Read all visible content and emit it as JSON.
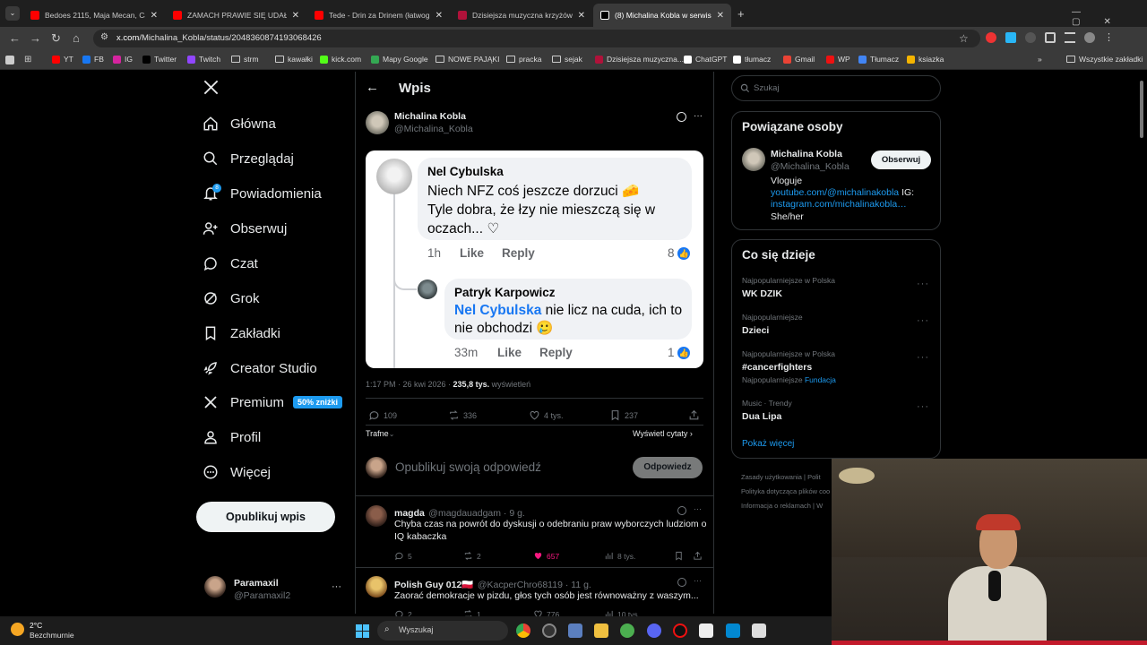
{
  "browser": {
    "tabs": [
      {
        "title": "Bedoes 2115, Maja Mecan, Cam",
        "color": "#ff0000",
        "active": false
      },
      {
        "title": "ZAMACH PRAWIE SIĘ UDAŁ - Yo",
        "color": "#ff0000",
        "active": false
      },
      {
        "title": "Tede - Drin za Drinem (łatwog",
        "color": "#ff0000",
        "active": false
      },
      {
        "title": "Dzisiejsza muzyczna krzyżówka",
        "color": "#b0123a",
        "active": false
      },
      {
        "title": "(8) Michalina Kobla w serwisie X",
        "color": "#000000",
        "active": true
      }
    ],
    "url_host": "x.com",
    "url_path": "/Michalina_Kobla/status/2048360874193068426",
    "bookmarks": [
      "YT",
      "FB",
      "IG",
      "Twitter",
      "Twitch",
      "strm",
      "kawałki",
      "kick.com",
      "Mapy Google",
      "NOWE PAJĄKI",
      "pracka",
      "sejak",
      "Dzisiejsza muzyczna...",
      "ChatGPT",
      "tłumacz",
      "Gmail",
      "WP",
      "Tłumacz",
      "ksiazka"
    ],
    "bookmarks_more": "»",
    "all_bookmarks": "Wszystkie zakładki"
  },
  "sidebar": {
    "items": [
      {
        "label": "Główna",
        "icon": "home-icon"
      },
      {
        "label": "Przeglądaj",
        "icon": "search-icon"
      },
      {
        "label": "Powiadomienia",
        "icon": "bell-icon"
      },
      {
        "label": "Obserwuj",
        "icon": "follow-icon"
      },
      {
        "label": "Czat",
        "icon": "chat-icon"
      },
      {
        "label": "Grok",
        "icon": "grok-icon"
      },
      {
        "label": "Zakładki",
        "icon": "bookmark-icon"
      },
      {
        "label": "Creator Studio",
        "icon": "rocket-icon"
      },
      {
        "label": "Premium",
        "icon": "x-logo-icon"
      },
      {
        "label": "Profil",
        "icon": "profile-icon"
      },
      {
        "label": "Więcej",
        "icon": "more-circle-icon"
      }
    ],
    "premium_badge": "50% zniżki",
    "notif_count": "8",
    "post_button": "Opublikuj wpis",
    "account_name": "Paramaxil",
    "account_handle": "@Paramaxil2",
    "account_more": "···"
  },
  "header": {
    "title": "Wpis"
  },
  "post": {
    "author_name": "Michalina Kobla",
    "author_handle": "@Michalina_Kobla",
    "timestamp": "1:17 PM · 26 kwi 2026 · ",
    "views_count": "235,8 tys.",
    "views_label": " wyświetleń",
    "replies": "109",
    "reposts": "336",
    "likes": "4 tys.",
    "bookmarks": "237",
    "sort_label": "Trafne",
    "quotes_label": "Wyświetl cytaty ›",
    "reply_placeholder": "Opublikuj swoją odpowiedź",
    "reply_button": "Odpowiedz"
  },
  "embedded": {
    "c1_name": "Nel Cybulska",
    "c1_line1": "Niech NFZ coś jeszcze dorzuci 🧀",
    "c1_line2": "Tyle dobra, że łzy nie mieszczą się w",
    "c1_line3": "oczach... ♡",
    "c1_time": "1h",
    "c1_like": "Like",
    "c1_reply": "Reply",
    "c1_count": "8",
    "c2_name": "Patryk Karpowicz",
    "c2_mention": "Nel Cybulska",
    "c2_line1": " nie licz na cuda, ich to",
    "c2_line2": "nie obchodzi 🥲",
    "c2_time": "33m",
    "c2_like": "Like",
    "c2_reply": "Reply",
    "c2_count": "1"
  },
  "replies": [
    {
      "name": "magda",
      "handle": "@magdauadgam · 9 g.",
      "text1": "Chyba czas na powrót do dyskusji o odebraniu praw wyborczych ludziom o",
      "text2": "IQ kabaczka",
      "replies": "5",
      "reposts": "2",
      "likes": "657",
      "views": "8 tys."
    },
    {
      "name": "Polish Guy 012🇵🇱",
      "handle": "@KacperChro68119 · 11 g.",
      "text1": "Zaorać demokracje w pizdu, głos tych osób jest równoważny z waszym...",
      "text2": "",
      "replies": "2",
      "reposts": "1",
      "likes": "776",
      "views": "10 tys."
    }
  ],
  "right": {
    "search_placeholder": "Szukaj",
    "related_title": "Powiązane osoby",
    "rel_name": "Michalina Kobla",
    "rel_handle": "@Michalina_Kobla",
    "follow_button": "Obserwuj",
    "bio1": "Vloguje",
    "bio_link1": "youtube.com/@michalinakobla",
    "bio_ig": " IG:",
    "bio_link2": "instagram.com/michalinakobla…",
    "bio3": "She/her",
    "trends_title": "Co się dzieje",
    "trends": [
      {
        "sub": "Najpopularniejsze w Polska",
        "title": "WK DZIK",
        "extra": "",
        "extra_link": ""
      },
      {
        "sub": "Najpopularniejsze",
        "title": "Dzieci",
        "extra": "",
        "extra_link": ""
      },
      {
        "sub": "Najpopularniejsze w Polska",
        "title": "#cancerfighters",
        "extra": "Najpopularniejsze ",
        "extra_link": "Fundacja"
      },
      {
        "sub": "Music · Trendy",
        "title": "Dua Lipa",
        "extra": "",
        "extra_link": ""
      }
    ],
    "show_more": "Pokaż więcej",
    "footer1": "Zasady użytkowania  |  Polit",
    "footer2": "Polityka dotycząca plików coo",
    "footer3": "Informacja o reklamach  |  W"
  },
  "taskbar": {
    "weather_temp": "2°C",
    "weather_desc": "Bezchmurnie",
    "search": "Wyszukaj"
  },
  "colors": {
    "accent": "#1d9bf0",
    "facebook_blue": "#1877f2",
    "like_pink": "#f91880"
  }
}
